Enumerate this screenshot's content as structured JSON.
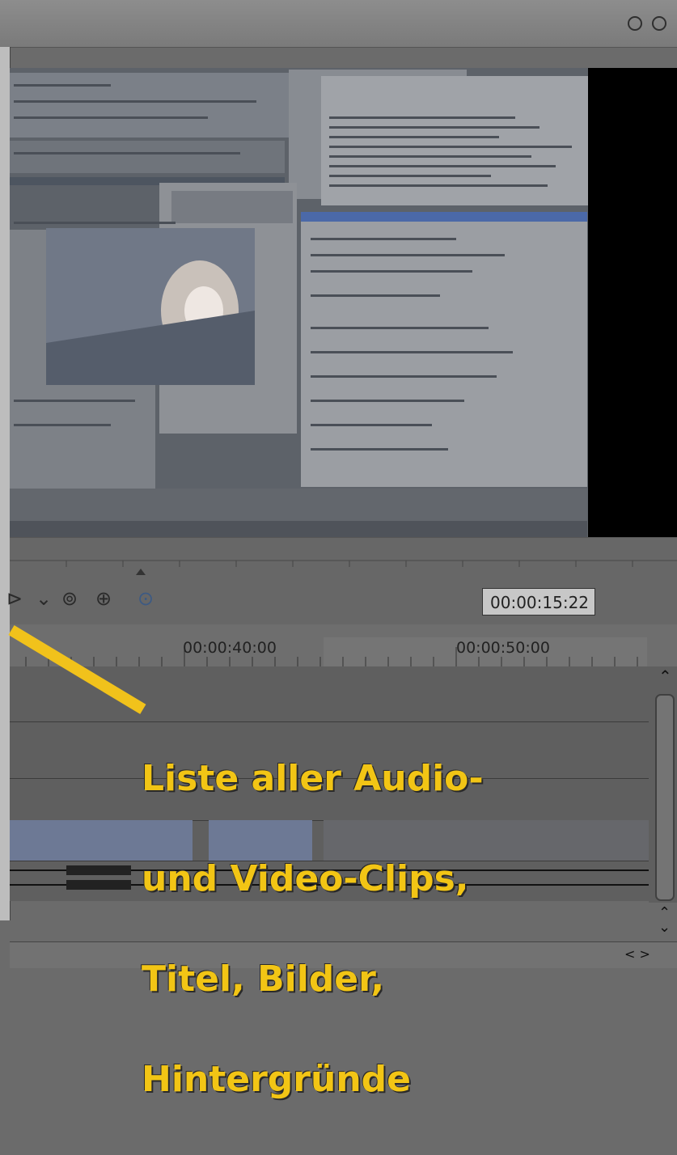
{
  "window": {
    "settings_icon": "gear-circle-icon",
    "close_icon": "close-circle-icon"
  },
  "monitor": {
    "description_colors": {
      "preview_bg": "#5a5f66",
      "black_area": "#000000"
    }
  },
  "transport": {
    "play_icon": "play-icon",
    "dropdown_icon": "chevron-down-icon",
    "next_icon": "skip-next-icon",
    "forward_icon": "fast-forward-icon",
    "zoom_icon": "zoom-icon",
    "timecode": "00:00:15:22"
  },
  "timeline": {
    "tick_labels": [
      "00:00:40:00",
      "00:00:50:00"
    ]
  },
  "annotation": {
    "lines": [
      "Liste aller Audio-",
      "und Video-Clips,",
      "Titel, Bilder,",
      "Hintergründe"
    ],
    "color": "#f2c515"
  },
  "scroll": {
    "up_icon": "chevron-up-icon",
    "down_icon": "chevron-down-icon",
    "hscroll_icon": "chevron-left-right-icon"
  }
}
